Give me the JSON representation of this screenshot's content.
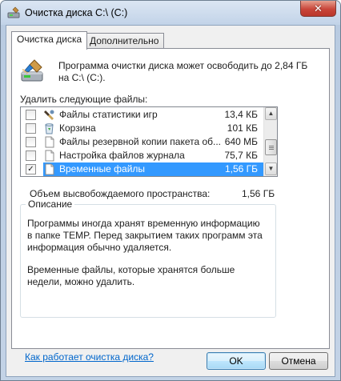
{
  "window": {
    "title": "Очистка диска C:\\ (C:)",
    "close_glyph": "✕"
  },
  "tabs": [
    {
      "label": "Очистка диска",
      "active": true
    },
    {
      "label": "Дополнительно",
      "active": false
    }
  ],
  "intro": {
    "icon": "disk-cleanup-icon",
    "text": "Программа очистки диска может освободить до 2,84 ГБ на C:\\ (C:)."
  },
  "files_section": {
    "label": "Удалить следующие файлы:",
    "items": [
      {
        "name": "Файлы статистики игр",
        "size": "13,4 КБ",
        "checked": false,
        "selected": false,
        "icon": "game-controller-icon"
      },
      {
        "name": "Корзина",
        "size": "101 КБ",
        "checked": false,
        "selected": false,
        "icon": "recycle-bin-icon"
      },
      {
        "name": "Файлы резервной копии пакета об...",
        "size": "640 МБ",
        "checked": false,
        "selected": false,
        "icon": "file-icon"
      },
      {
        "name": "Настройка файлов журнала",
        "size": "75,7 КБ",
        "checked": false,
        "selected": false,
        "icon": "file-icon"
      },
      {
        "name": "Временные файлы",
        "size": "1,56 ГБ",
        "checked": true,
        "selected": true,
        "icon": "file-icon"
      }
    ]
  },
  "space": {
    "label": "Объем высвобождаемого пространства:",
    "value": "1,56 ГБ"
  },
  "description": {
    "title": "Описание",
    "text1": "Программы иногда хранят временную информацию в папке TEMP. Перед закрытием таких программ эта информация обычно удаляется.",
    "text2": "Временные файлы, которые хранятся больше недели, можно удалить."
  },
  "help_link": "Как работает очистка диска?",
  "buttons": {
    "ok": "OK",
    "cancel": "Отмена"
  },
  "colors": {
    "selection": "#3399ff",
    "link": "#0066cc",
    "close_button": "#c9463a"
  }
}
